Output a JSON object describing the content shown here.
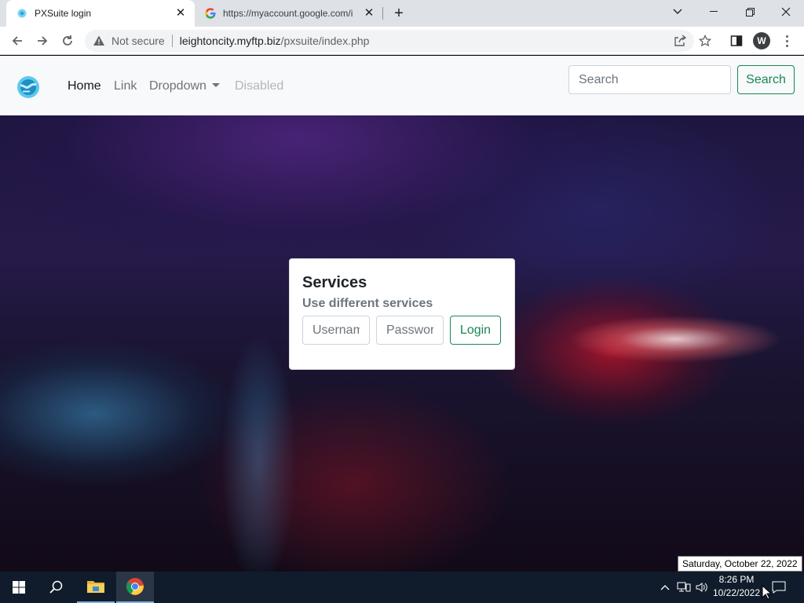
{
  "browser": {
    "tabs": [
      {
        "title": "PXSuite login",
        "active": true
      },
      {
        "title": "https://myaccount.google.com/i",
        "active": false
      }
    ],
    "address": {
      "security_label": "Not secure",
      "host": "leightoncity.myftp.biz",
      "path": "/pxsuite/index.php"
    },
    "profile_initial": "W"
  },
  "navbar": {
    "links": [
      {
        "label": "Home",
        "state": "active"
      },
      {
        "label": "Link",
        "state": "normal"
      },
      {
        "label": "Dropdown",
        "state": "dropdown"
      },
      {
        "label": "Disabled",
        "state": "disabled"
      }
    ],
    "search_placeholder": "Search",
    "search_button": "Search"
  },
  "login_card": {
    "title": "Services",
    "subtitle": "Use different services",
    "username_placeholder": "Username",
    "password_placeholder": "Password",
    "login_button": "Login"
  },
  "taskbar": {
    "time": "8:26 PM",
    "date": "10/22/2022",
    "date_tooltip": "Saturday, October 22, 2022"
  },
  "colors": {
    "accent_green": "#198754",
    "navbar_bg": "#f8f9fa",
    "taskbar_bg": "#101c2b"
  }
}
